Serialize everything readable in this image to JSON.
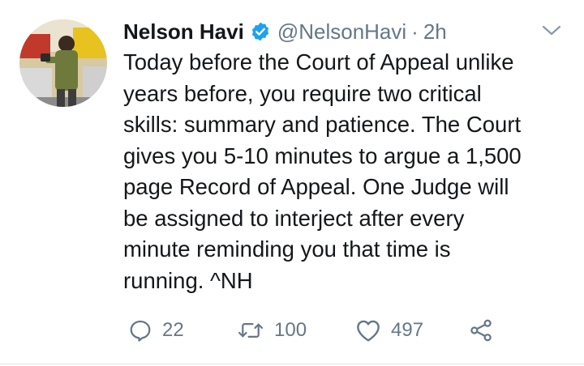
{
  "tweet": {
    "author_name": "Nelson Havi",
    "handle": "@NelsonHavi",
    "separator": "·",
    "time": "2h",
    "text_lines": [
      "Today before the Court of Appeal unlike",
      "years before, you require two critical",
      "skills: summary and patience. The Court",
      "gives you 5-10 minutes to argue a 1,500",
      "page Record of Appeal. One Judge will",
      "be assigned to interject after every",
      "minute reminding you that time is",
      "running. ^NH"
    ],
    "reply_count": "22",
    "retweet_count": "100",
    "like_count": "497"
  },
  "icons": {
    "verified": "verified-badge-icon",
    "caret": "chevron-down-icon",
    "reply": "reply-icon",
    "retweet": "retweet-icon",
    "like": "heart-icon",
    "share": "share-icon"
  },
  "colors": {
    "text": "#14171a",
    "secondary": "#657786",
    "verified_blue": "#1da1f2",
    "divider": "#e1e8ed"
  }
}
